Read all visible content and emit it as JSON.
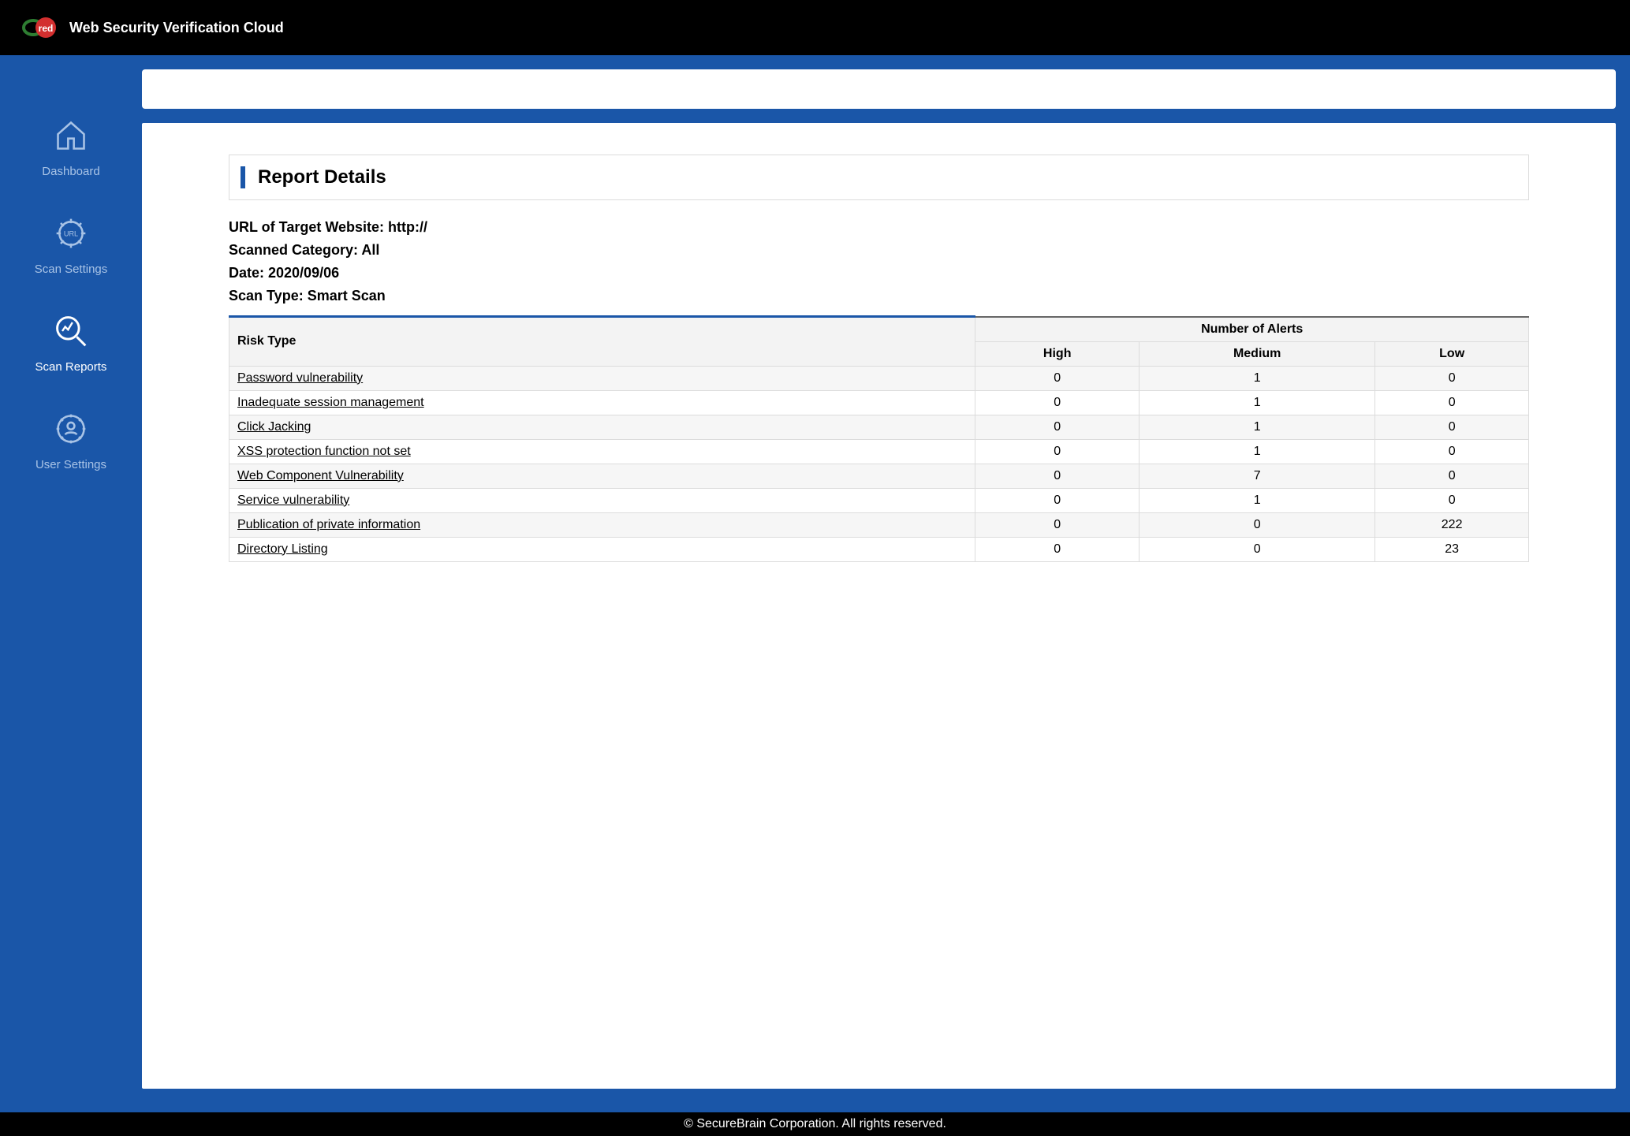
{
  "app": {
    "title": "Web Security Verification Cloud"
  },
  "sidebar": {
    "items": [
      {
        "label": "Dashboard"
      },
      {
        "label": "Scan Settings"
      },
      {
        "label": "Scan Reports"
      },
      {
        "label": "User Settings"
      }
    ]
  },
  "report": {
    "title": "Report Details",
    "meta": [
      {
        "label": "URL of Target Website: ",
        "value": "http://"
      },
      {
        "label": "Scanned Category: ",
        "value": "All"
      },
      {
        "label": "Date: ",
        "value": "2020/09/06"
      },
      {
        "label": "Scan Type: ",
        "value": "Smart Scan"
      }
    ],
    "columns": {
      "risk": "Risk Type",
      "alerts_group": "Number of Alerts",
      "high": "High",
      "medium": "Medium",
      "low": "Low"
    },
    "rows": [
      {
        "name": "Password vulnerability",
        "high": "0",
        "medium": "1",
        "low": "0"
      },
      {
        "name": "Inadequate session management",
        "high": "0",
        "medium": "1",
        "low": "0"
      },
      {
        "name": "Click Jacking",
        "high": "0",
        "medium": "1",
        "low": "0"
      },
      {
        "name": "XSS protection function not set",
        "high": "0",
        "medium": "1",
        "low": "0"
      },
      {
        "name": "Web Component Vulnerability",
        "high": "0",
        "medium": "7",
        "low": "0"
      },
      {
        "name": "Service vulnerability",
        "high": "0",
        "medium": "1",
        "low": "0"
      },
      {
        "name": "Publication of private information",
        "high": "0",
        "medium": "0",
        "low": "222"
      },
      {
        "name": "Directory Listing",
        "high": "0",
        "medium": "0",
        "low": "23"
      }
    ]
  },
  "footer": {
    "copyright": "© SecureBrain Corporation. All rights reserved."
  }
}
